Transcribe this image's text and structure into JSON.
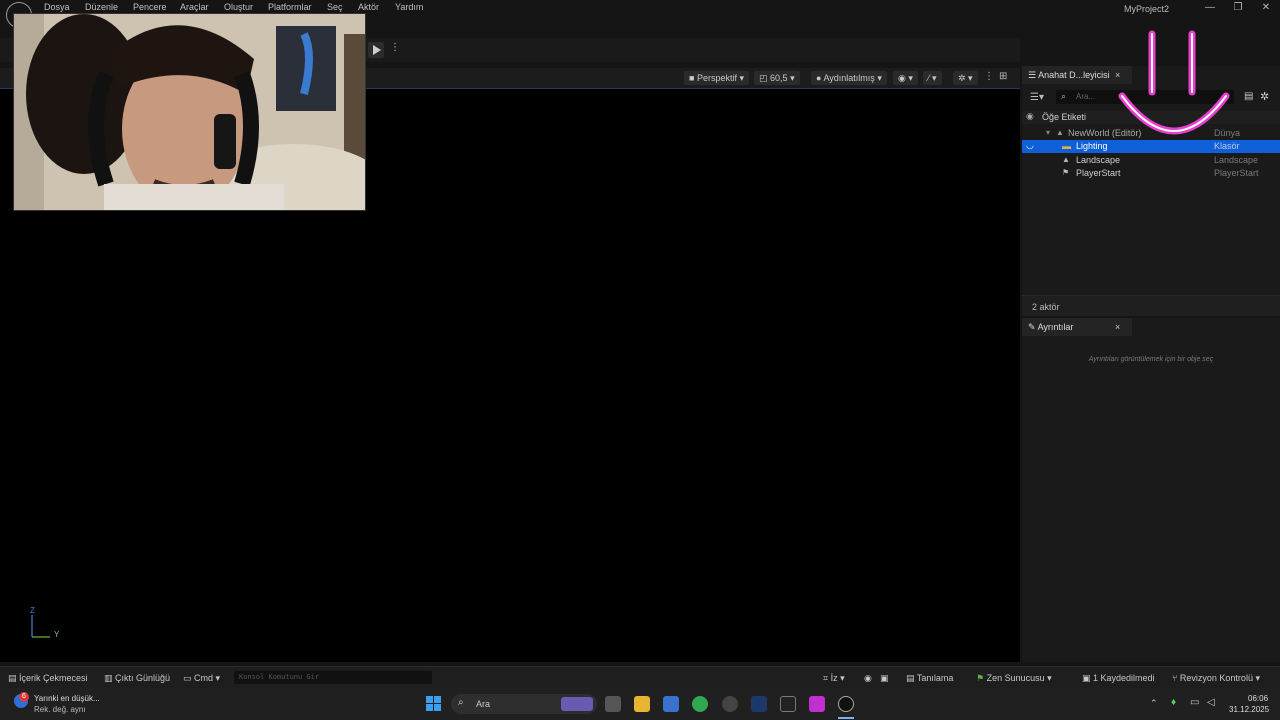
{
  "menu": {
    "items": [
      "Dosya",
      "Düzenle",
      "Pencere",
      "Araçlar",
      "Oluştur",
      "Platformlar",
      "Seç",
      "Aktör",
      "Yardım"
    ],
    "project_name": "MyProject2",
    "window_controls": [
      "—",
      "❐",
      "✕"
    ]
  },
  "viewport": {
    "perspective_label": "Perspektif",
    "fov_label": "60,5",
    "lighting_label": "Aydınlatılmış",
    "axis_z": "Z",
    "axis_y": "Y"
  },
  "outliner": {
    "tab_title": "Anahat D...leyicisi",
    "search_placeholder": "Ara...",
    "header_label": "Öğe Etiketi",
    "rows": [
      {
        "name": "NewWorld (Editör)",
        "type": "Dünya"
      },
      {
        "name": "Lighting",
        "type": "Klasör"
      },
      {
        "name": "Landscape",
        "type": "Landscape"
      },
      {
        "name": "PlayerStart",
        "type": "PlayerStart"
      }
    ],
    "actor_count": "2 aktör"
  },
  "details": {
    "tab_title": "Ayrıntılar",
    "empty_message": "Ayrıntıları görüntülemek için bir obje seç"
  },
  "statusbar": {
    "content_drawer": "İçerik Çekmecesi",
    "output_log": "Çıktı Günlüğü",
    "cmd": "Cmd",
    "console_placeholder": "Konsol Komutunu Gir",
    "trace": "İz",
    "diagnostics": "Tanılama",
    "zen_server": "Zen Sunucusu",
    "unsaved": "1 Kaydedilmedi",
    "revision_control": "Revizyon Kontrolü"
  },
  "taskbar": {
    "weather_title": "Yarınki en düşük...",
    "weather_sub": "Rek. değ. aynı",
    "weather_badge": "6",
    "search_label": "Ara",
    "time": "06:06",
    "date": "31.12.2025"
  },
  "colors": {
    "selection": "#0e5fd8",
    "accent_pink": "#e83fd0"
  }
}
